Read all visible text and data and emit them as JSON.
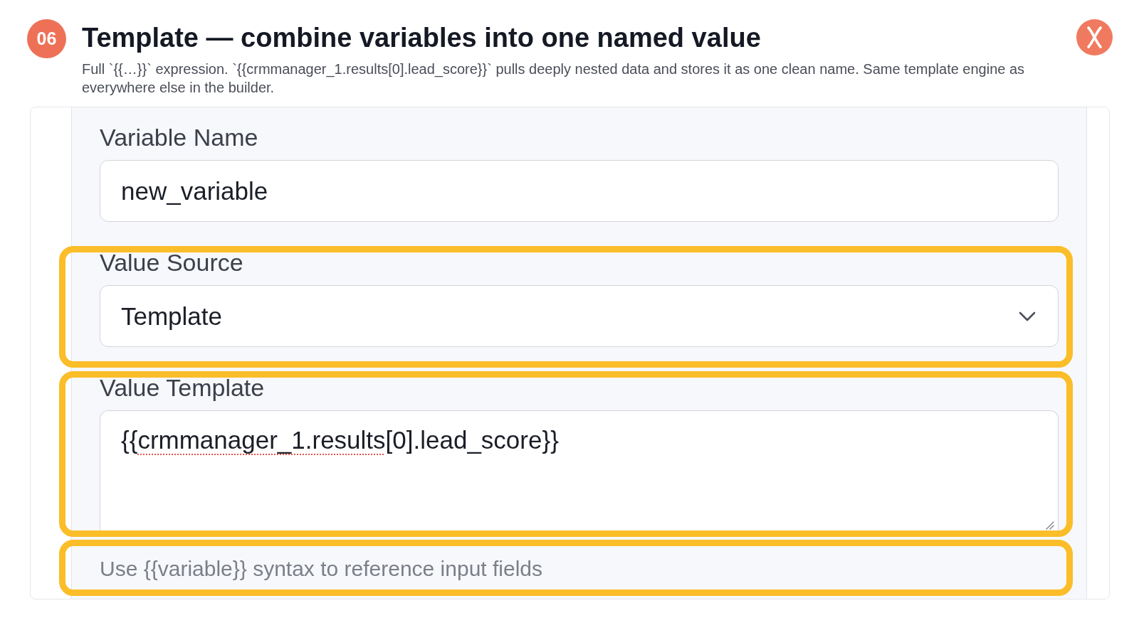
{
  "header": {
    "step": "06",
    "title": "Template — combine variables into one named value",
    "subtitle": "Full `{{…}}` expression. `{{crmmanager_1.results[0].lead_score}}` pulls deeply nested data and stores it as one clean name. Same template engine as everywhere else in the builder."
  },
  "form": {
    "fields": [
      {
        "kind": "text",
        "label": "Variable Name",
        "value": "new_variable",
        "highlighted": false
      },
      {
        "kind": "select",
        "label": "Value Source",
        "value": "Template",
        "highlighted": true
      },
      {
        "kind": "textarea",
        "label": "Value Template",
        "value_parts": [
          {
            "text": "{{",
            "misspelled": false
          },
          {
            "text": "crmmanager_1.results",
            "misspelled": true
          },
          {
            "text": "[0].lead_score}}",
            "misspelled": false
          }
        ],
        "highlighted": true
      }
    ],
    "help": {
      "text": "Use {{variable}} syntax to reference input fields",
      "highlighted": true
    }
  }
}
